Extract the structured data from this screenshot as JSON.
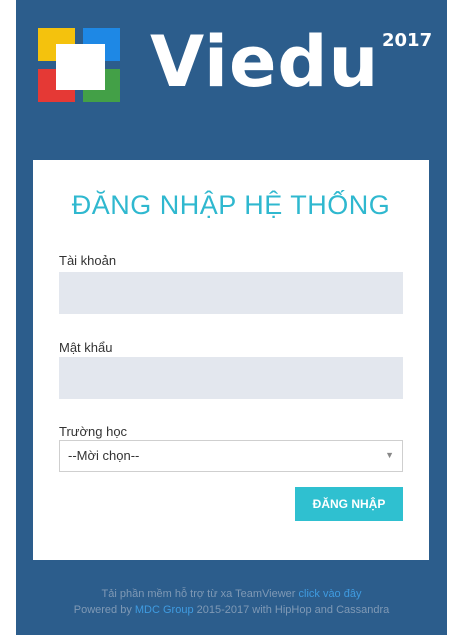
{
  "brand": {
    "name": "Viedu",
    "year": "2017",
    "colors": {
      "background": "#2c5d8c",
      "accent": "#2fc0d0",
      "logo_yellow": "#f4c20d",
      "logo_blue": "#1e88e5",
      "logo_red": "#e53935",
      "logo_green": "#43a047"
    }
  },
  "login": {
    "title": "ĐĂNG NHẬP HỆ THỐNG",
    "username_label": "Tài khoản",
    "username_value": "",
    "password_label": "Mật khẩu",
    "password_value": "",
    "school_label": "Trường học",
    "school_selected": "--Mời chọn--",
    "submit_label": "ĐĂNG NHẬP"
  },
  "footer": {
    "support_text": "Tải phần mềm hỗ trợ từ xa TeamViewer ",
    "support_link": "click vào đây",
    "powered_prefix": "Powered by ",
    "powered_link": "MDC Group",
    "powered_suffix": " 2015-2017 with HipHop and Cassandra"
  }
}
